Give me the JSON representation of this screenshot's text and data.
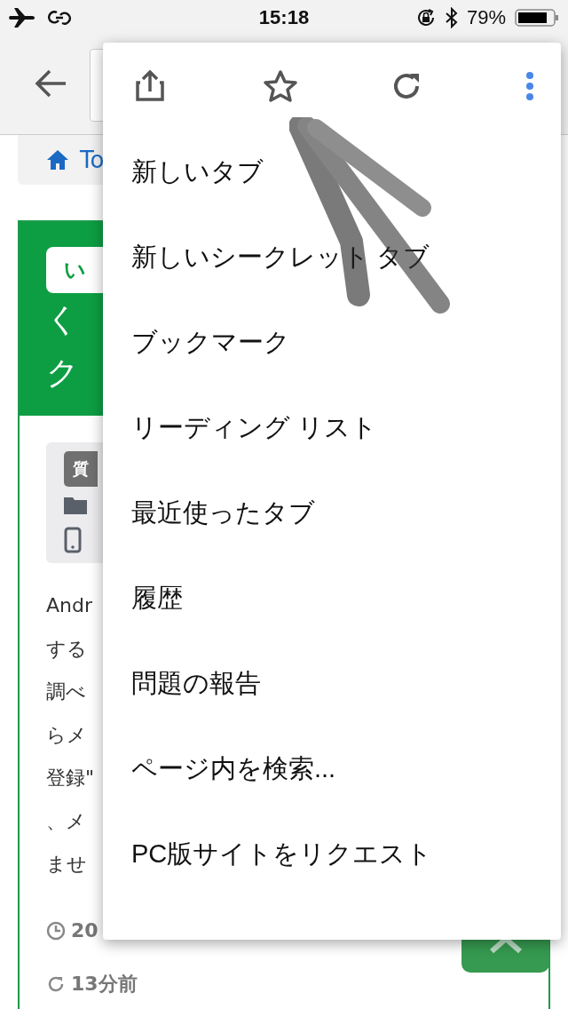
{
  "status_bar": {
    "time": "15:18",
    "battery": "79%"
  },
  "page": {
    "breadcrumb": "To",
    "banner_badge": "い",
    "banner_lines": [
      "く",
      "ク"
    ],
    "info_badge": "質",
    "paragraph_lines": [
      "Andr",
      "する",
      "調べ",
      "らメ",
      "登録\"",
      "、メ",
      "ませ"
    ],
    "posted": "20",
    "updated": "13分前"
  },
  "menu": {
    "items": [
      {
        "label": "新しいタブ"
      },
      {
        "label": "新しいシークレット タブ"
      },
      {
        "label": "ブックマーク"
      },
      {
        "label": "リーディング リスト"
      },
      {
        "label": "最近使ったタブ"
      },
      {
        "label": "履歴"
      },
      {
        "label": "問題の報告"
      },
      {
        "label": "ページ内を検索..."
      },
      {
        "label": "PC版サイトをリクエスト"
      }
    ]
  }
}
